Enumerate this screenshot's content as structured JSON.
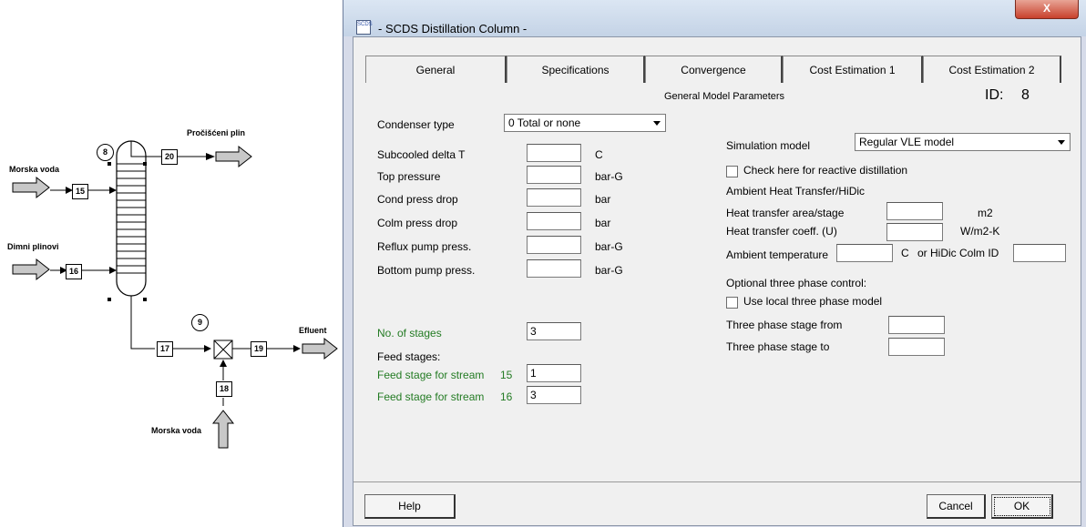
{
  "flowsheet": {
    "labels": {
      "morska_voda_top": "Morska voda",
      "dimni_plinovi": "Dimni plinovi",
      "prociseni_plin": "Pročišćeni plin",
      "efluent": "Efluent",
      "morska_voda_bottom": "Morska voda"
    },
    "units": {
      "column": "8",
      "mixer": "9"
    },
    "streams": {
      "s15": "15",
      "s16": "16",
      "s17": "17",
      "s18": "18",
      "s19": "19",
      "s20": "20"
    }
  },
  "window": {
    "title": "- SCDS Distillation Column -",
    "close": "X",
    "icon_text": "SCDS"
  },
  "tabs": [
    "General",
    "Specifications",
    "Convergence",
    "Cost Estimation 1",
    "Cost Estimation 2"
  ],
  "general": {
    "heading": "General Model Parameters",
    "id_label": "ID:",
    "id_value": "8",
    "condenser_label": "Condenser type",
    "condenser_value": "0 Total or none",
    "rows": {
      "subcooled": {
        "label": "Subcooled delta T",
        "unit": "C",
        "value": ""
      },
      "top_pressure": {
        "label": "Top pressure",
        "unit": "bar-G",
        "value": ""
      },
      "cond_drop": {
        "label": "Cond press drop",
        "unit": "bar",
        "value": ""
      },
      "colm_drop": {
        "label": "Colm press drop",
        "unit": "bar",
        "value": ""
      },
      "reflux_pump": {
        "label": "Reflux pump press.",
        "unit": "bar-G",
        "value": ""
      },
      "bottom_pump": {
        "label": "Bottom pump press.",
        "unit": "bar-G",
        "value": ""
      }
    },
    "stages_label": "No. of stages",
    "stages_value": "3",
    "feed_stages_label": "Feed stages:",
    "feed1_label": "Feed stage for stream",
    "feed1_stream": "15",
    "feed1_value": "1",
    "feed2_label": "Feed stage for stream",
    "feed2_stream": "16",
    "feed2_value": "3",
    "simulation_label": "Simulation model",
    "simulation_value": "Regular VLE model",
    "reactive_label": "Check here for reactive distillation",
    "ambient_heading": "Ambient Heat Transfer/HiDic",
    "ht_area_label": "Heat transfer area/stage",
    "ht_area_unit": "m2",
    "ht_area_value": "",
    "ht_coeff_label": "Heat transfer coeff. (U)",
    "ht_coeff_unit": "W/m2-K",
    "ht_coeff_value": "",
    "ambient_temp_label": "Ambient temperature",
    "ambient_temp_unit": "C",
    "ambient_temp_value": "",
    "hidic_label": "or HiDic Colm ID",
    "hidic_value": "",
    "three_phase_heading": "Optional three phase control:",
    "three_phase_cb_label": "Use local three phase model",
    "tp_from_label": "Three phase stage from",
    "tp_from_value": "",
    "tp_to_label": "Three phase stage to",
    "tp_to_value": ""
  },
  "buttons": {
    "help": "Help",
    "cancel": "Cancel",
    "ok": "OK"
  }
}
